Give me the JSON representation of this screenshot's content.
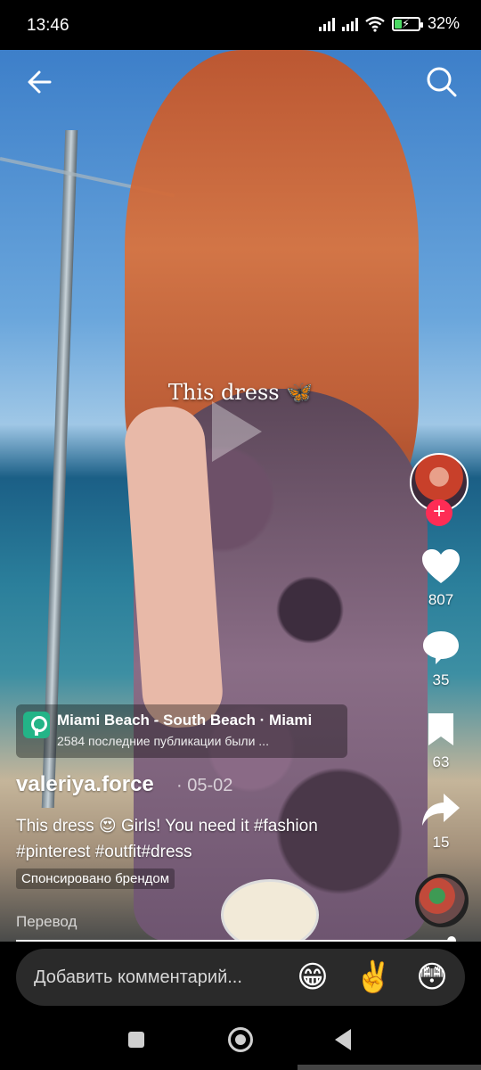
{
  "status_bar": {
    "time": "13:46",
    "battery_percent": "32%",
    "battery_level": 0.32,
    "icons": [
      "signal-icon",
      "signal-icon",
      "wifi-icon",
      "battery-charging-icon"
    ]
  },
  "video": {
    "overlay_text": "This dress 🦋",
    "progress": 0.99
  },
  "top_bar": {
    "back_icon": "arrow-left-icon",
    "search_icon": "search-icon"
  },
  "actions": {
    "likes": "807",
    "comments": "35",
    "favorites": "63",
    "shares": "15",
    "follow_symbol": "+"
  },
  "location": {
    "title": "Miami Beach - South Beach · Miami",
    "subtitle": "2584 последние публикации были ..."
  },
  "post": {
    "username": "valeriya.force",
    "date": "· 05-02",
    "caption": "This dress 😍 Girls! You need it #fashion #pinterest #outfit#dress",
    "sponsored": "Спонсировано брендом",
    "translate": "Перевод"
  },
  "comment_bar": {
    "placeholder": "Добавить комментарий...",
    "emojis": [
      "😁",
      "✌️",
      "😳"
    ]
  },
  "colors": {
    "follow": "#fe2c55",
    "location_icon": "#23b487",
    "battery": "#4cd964"
  }
}
